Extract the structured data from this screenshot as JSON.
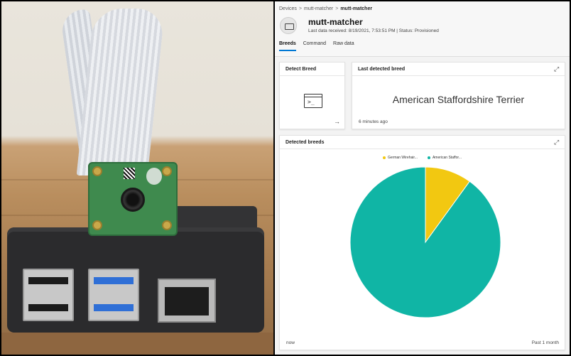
{
  "breadcrumb": {
    "devices": "Devices",
    "sep1": ">",
    "template": "mutt-matcher",
    "sep2": ">",
    "device": "mutt-matcher"
  },
  "device": {
    "name": "mutt-matcher",
    "meta": "Last data received: 8/19/2021, 7:53:51 PM  |  Status: Provisioned",
    "icon": "device-icon"
  },
  "tabs": [
    {
      "label": "Breeds",
      "active": true
    },
    {
      "label": "Command",
      "active": false
    },
    {
      "label": "Raw data",
      "active": false
    }
  ],
  "cards": {
    "detect": {
      "title": "Detect Breed",
      "icon": "terminal-icon",
      "prompt": ">_"
    },
    "last": {
      "title": "Last detected breed",
      "value": "American Staffordshire Terrier",
      "time": "6 minutes ago"
    },
    "chart": {
      "title": "Detected breeds",
      "footer_left": "now",
      "footer_right": "Past 1 month"
    }
  },
  "icons": {
    "expand": "⤢",
    "arrow": "→"
  },
  "colors": {
    "accent": "#0078d4",
    "teal": "#10b5a5",
    "yellow": "#f2c811"
  },
  "chart_data": {
    "type": "pie",
    "title": "Detected breeds",
    "series": [
      {
        "name": "German Wirehair...",
        "value": 10,
        "color": "#f2c811"
      },
      {
        "name": "American Staffor...",
        "value": 90,
        "color": "#10b5a5"
      }
    ],
    "legend_position": "top-center"
  }
}
